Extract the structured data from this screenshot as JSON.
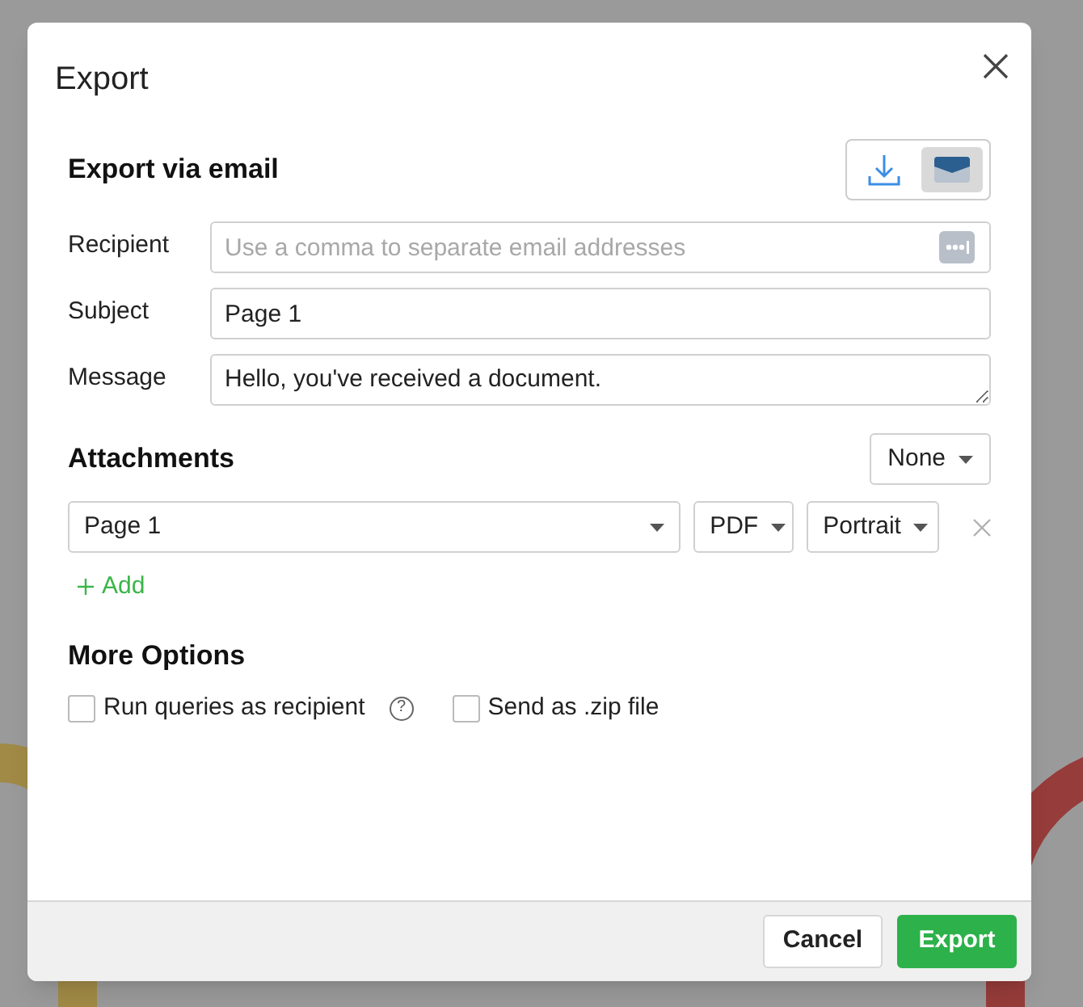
{
  "dialog": {
    "title": "Export",
    "section_title": "Export via email",
    "export_modes": [
      {
        "kind": "download",
        "selected": false
      },
      {
        "kind": "email",
        "selected": true
      }
    ],
    "fields": [
      {
        "label": "Recipient",
        "kind": "input",
        "placeholder": "Use a comma to separate email addresses"
      },
      {
        "label": "Subject",
        "kind": "input",
        "value": "Page 1"
      },
      {
        "label": "Message",
        "kind": "textarea",
        "value": "Hello, you've received a document."
      }
    ],
    "attachments": {
      "title": "Attachments",
      "filter": "None",
      "items": [
        {
          "page": "Page 1",
          "format": "PDF",
          "orientation": "Portrait"
        }
      ],
      "add_label": "Add"
    },
    "more_options": {
      "title": "More Options",
      "options": [
        {
          "label": "Run queries as recipient",
          "checked": false,
          "help": "?"
        },
        {
          "label": "Send as .zip file",
          "checked": false
        }
      ]
    },
    "buttons": [
      {
        "label": "Cancel",
        "kind": "secondary"
      },
      {
        "label": "Export",
        "kind": "primary"
      }
    ]
  }
}
